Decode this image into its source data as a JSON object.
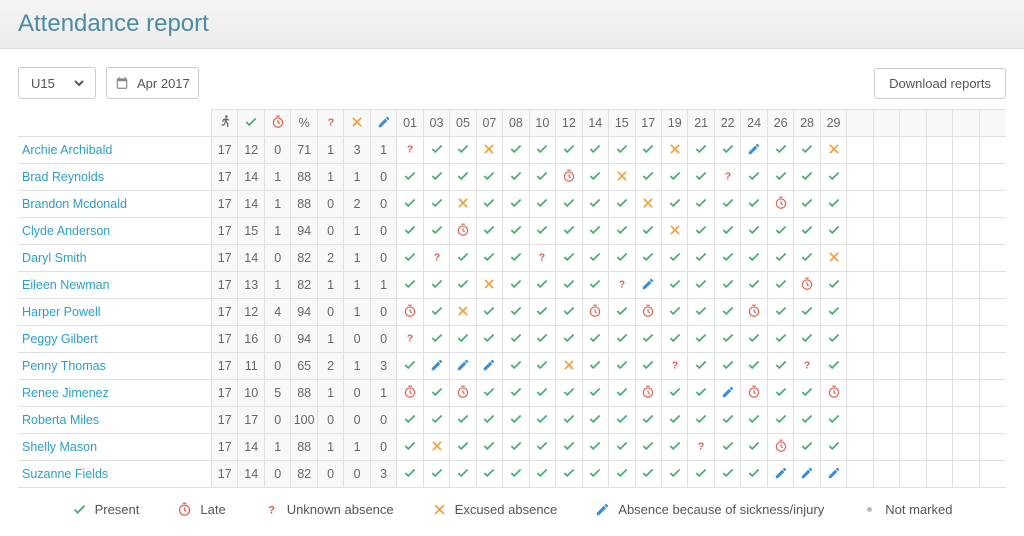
{
  "title": "Attendance report",
  "team_select": "U15",
  "month_label": "Apr 2017",
  "download_label": "Download reports",
  "header_cols": [
    "running",
    "present",
    "late",
    "%",
    "unknown",
    "excused",
    "sick"
  ],
  "date_cols": [
    "01",
    "03",
    "05",
    "07",
    "08",
    "10",
    "12",
    "14",
    "15",
    "17",
    "19",
    "21",
    "22",
    "24",
    "26",
    "28",
    "29"
  ],
  "extra_cols": 6,
  "legend": {
    "present": "Present",
    "late": "Late",
    "unknown": "Unknown absence",
    "excused": "Excused absence",
    "sick": "Absence because of sickness/injury",
    "notmarked": "Not marked"
  },
  "players": [
    {
      "name": "Archie Archibald",
      "stats": [
        17,
        12,
        0,
        71,
        1,
        3,
        1
      ],
      "days": [
        "U",
        "P",
        "P",
        "X",
        "P",
        "P",
        "P",
        "P",
        "P",
        "P",
        "X",
        "P",
        "P",
        "S",
        "P",
        "P",
        "X"
      ]
    },
    {
      "name": "Brad Reynolds",
      "stats": [
        17,
        14,
        1,
        88,
        1,
        1,
        0
      ],
      "days": [
        "P",
        "P",
        "P",
        "P",
        "P",
        "P",
        "L",
        "P",
        "X",
        "P",
        "P",
        "P",
        "U",
        "P",
        "P",
        "P",
        "P"
      ]
    },
    {
      "name": "Brandon Mcdonald",
      "stats": [
        17,
        14,
        1,
        88,
        0,
        2,
        0
      ],
      "days": [
        "P",
        "P",
        "X",
        "P",
        "P",
        "P",
        "P",
        "P",
        "P",
        "X",
        "P",
        "P",
        "P",
        "P",
        "L",
        "P",
        "P"
      ]
    },
    {
      "name": "Clyde Anderson",
      "stats": [
        17,
        15,
        1,
        94,
        0,
        1,
        0
      ],
      "days": [
        "P",
        "P",
        "L",
        "P",
        "P",
        "P",
        "P",
        "P",
        "P",
        "P",
        "X",
        "P",
        "P",
        "P",
        "P",
        "P",
        "P"
      ]
    },
    {
      "name": "Daryl Smith",
      "stats": [
        17,
        14,
        0,
        82,
        2,
        1,
        0
      ],
      "days": [
        "P",
        "U",
        "P",
        "P",
        "P",
        "U",
        "P",
        "P",
        "P",
        "P",
        "P",
        "P",
        "P",
        "P",
        "P",
        "P",
        "X"
      ]
    },
    {
      "name": "Eileen Newman",
      "stats": [
        17,
        13,
        1,
        82,
        1,
        1,
        1
      ],
      "days": [
        "P",
        "P",
        "P",
        "X",
        "P",
        "P",
        "P",
        "P",
        "U",
        "S",
        "P",
        "P",
        "P",
        "P",
        "P",
        "L",
        "P"
      ]
    },
    {
      "name": "Harper Powell",
      "stats": [
        17,
        12,
        4,
        94,
        0,
        1,
        0
      ],
      "days": [
        "L",
        "P",
        "X",
        "P",
        "P",
        "P",
        "P",
        "L",
        "P",
        "L",
        "P",
        "P",
        "P",
        "L",
        "P",
        "P",
        "P"
      ]
    },
    {
      "name": "Peggy Gilbert",
      "stats": [
        17,
        16,
        0,
        94,
        1,
        0,
        0
      ],
      "days": [
        "U",
        "P",
        "P",
        "P",
        "P",
        "P",
        "P",
        "P",
        "P",
        "P",
        "P",
        "P",
        "P",
        "P",
        "P",
        "P",
        "P"
      ]
    },
    {
      "name": "Penny Thomas",
      "stats": [
        17,
        11,
        0,
        65,
        2,
        1,
        3
      ],
      "days": [
        "P",
        "S",
        "S",
        "S",
        "P",
        "P",
        "X",
        "P",
        "P",
        "P",
        "U",
        "P",
        "P",
        "P",
        "P",
        "U",
        "P"
      ]
    },
    {
      "name": "Renee Jimenez",
      "stats": [
        17,
        10,
        5,
        88,
        1,
        0,
        1
      ],
      "days": [
        "L",
        "P",
        "L",
        "P",
        "P",
        "P",
        "P",
        "P",
        "P",
        "L",
        "P",
        "P",
        "S",
        "L",
        "P",
        "P",
        "L"
      ]
    },
    {
      "name": "Roberta Miles",
      "stats": [
        17,
        17,
        0,
        100,
        0,
        0,
        0
      ],
      "days": [
        "P",
        "P",
        "P",
        "P",
        "P",
        "P",
        "P",
        "P",
        "P",
        "P",
        "P",
        "P",
        "P",
        "P",
        "P",
        "P",
        "P"
      ]
    },
    {
      "name": "Shelly Mason",
      "stats": [
        17,
        14,
        1,
        88,
        1,
        1,
        0
      ],
      "days": [
        "P",
        "X",
        "P",
        "P",
        "P",
        "P",
        "P",
        "P",
        "P",
        "P",
        "P",
        "U",
        "P",
        "P",
        "L",
        "P",
        "P"
      ]
    },
    {
      "name": "Suzanne Fields",
      "stats": [
        17,
        14,
        0,
        82,
        0,
        0,
        3
      ],
      "days": [
        "P",
        "P",
        "P",
        "P",
        "P",
        "P",
        "P",
        "P",
        "P",
        "P",
        "P",
        "P",
        "P",
        "P",
        "S",
        "S",
        "S"
      ]
    }
  ]
}
